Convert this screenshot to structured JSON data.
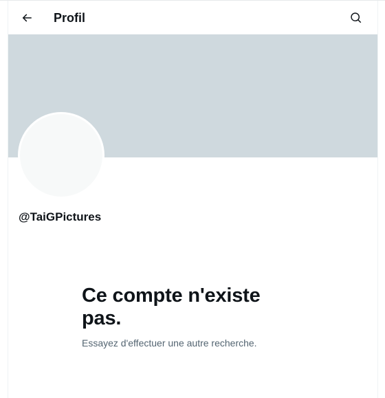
{
  "header": {
    "back_icon": "arrow-left-icon",
    "title": "Profil",
    "search_icon": "search-icon"
  },
  "profile": {
    "banner_color": "#cfd9de",
    "avatar_color": "#f7f9f9",
    "handle": "@TaiGPictures"
  },
  "empty_state": {
    "title": "Ce compte n'existe pas.",
    "subtitle": "Essayez d'effectuer une autre recherche."
  }
}
